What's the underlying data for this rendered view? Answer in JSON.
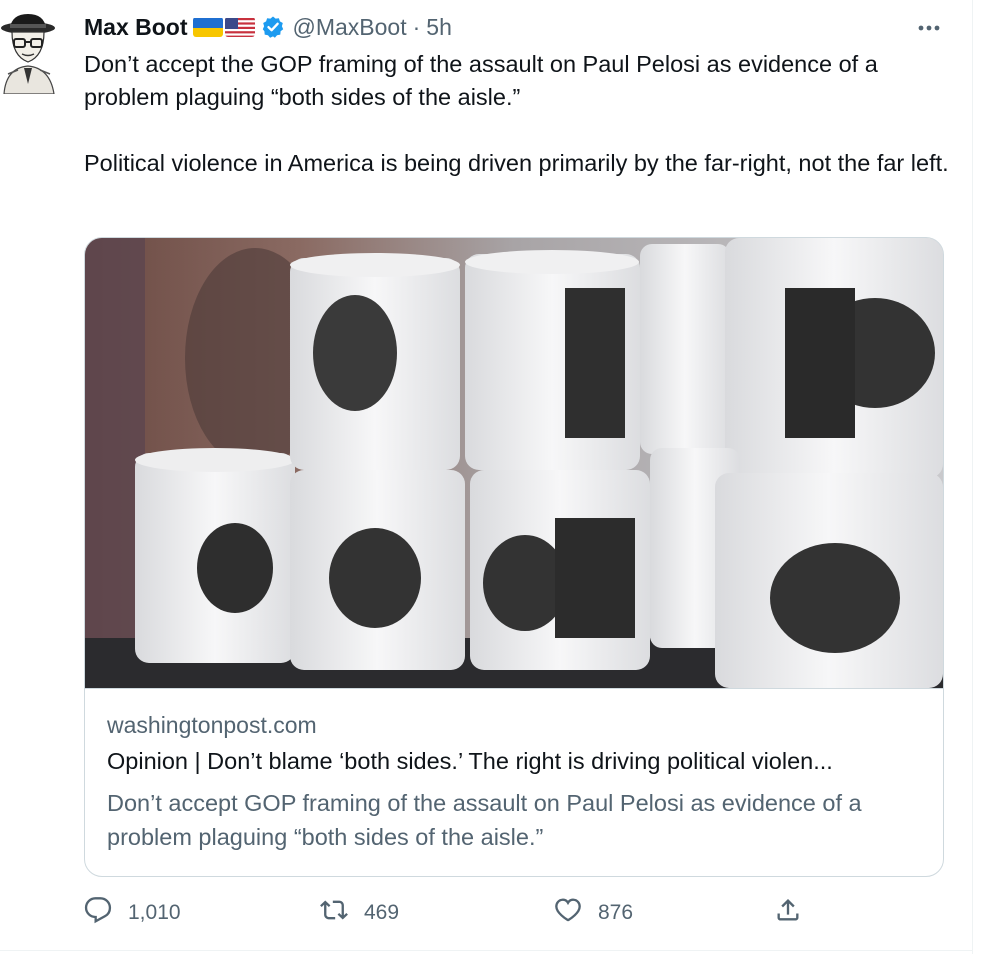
{
  "tweet": {
    "author_name": "Max Boot",
    "handle": "@MaxBoot",
    "separator": "·",
    "time": "5h",
    "text_paragraphs": [
      "Don’t accept the GOP framing of the assault on Paul Pelosi as evidence of a problem plaguing “both sides of the aisle.”",
      "Political violence in America is being driven primarily by the far-right, not the far left."
    ]
  },
  "card": {
    "domain": "washingtonpost.com",
    "title": "Opinion | Don’t blame ‘both sides.’ The right is driving political violen...",
    "description": "Don’t accept GOP framing of the assault on Paul Pelosi as evidence of a problem plaguing “both sides of the aisle.”"
  },
  "actions": {
    "replies": "1,010",
    "retweets": "469",
    "likes": "876"
  },
  "icons": {
    "verified": "verified-badge-icon",
    "more": "more-options-icon",
    "reply": "reply-icon",
    "retweet": "retweet-icon",
    "like": "heart-icon",
    "share": "share-icon",
    "flags": [
      "ukraine-flag-icon",
      "us-flag-icon"
    ]
  },
  "colors": {
    "text": "#0f1419",
    "secondary": "#536471",
    "verified": "#1d9bf0",
    "border": "#cfd9de"
  }
}
